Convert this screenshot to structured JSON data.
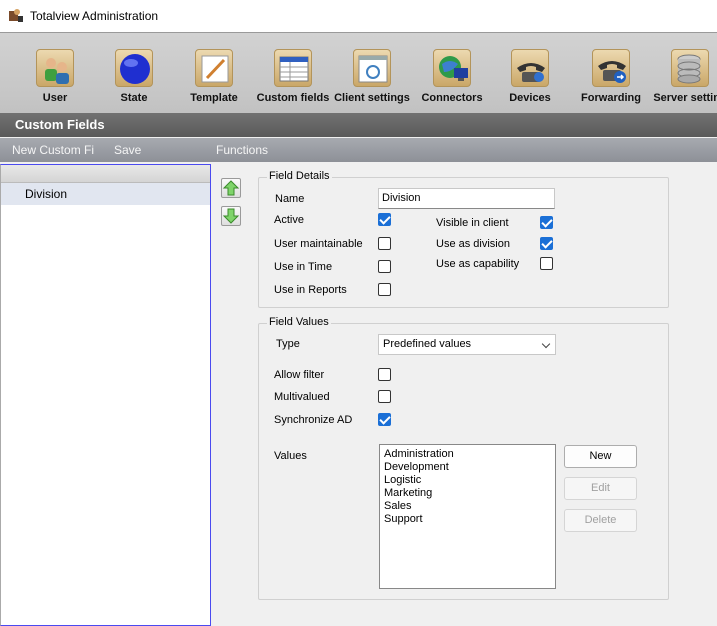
{
  "window": {
    "title": "Totalview  Administration"
  },
  "toolbar": {
    "items": [
      {
        "label": "User",
        "icon": "users-icon"
      },
      {
        "label": "State",
        "icon": "state-orb-icon"
      },
      {
        "label": "Template",
        "icon": "template-icon"
      },
      {
        "label": "Custom fields",
        "icon": "custom-fields-icon"
      },
      {
        "label": "Client settings",
        "icon": "client-settings-icon"
      },
      {
        "label": "Connectors",
        "icon": "connectors-icon"
      },
      {
        "label": "Devices",
        "icon": "devices-phone-icon"
      },
      {
        "label": "Forwarding",
        "icon": "forwarding-phone-icon"
      },
      {
        "label": "Server setting",
        "icon": "server-database-icon"
      }
    ],
    "section_title": "Custom Fields"
  },
  "menu": {
    "new": "New Custom Fi",
    "save": "Save",
    "functions": "Functions"
  },
  "field_list": {
    "items": [
      "Division"
    ]
  },
  "field_details": {
    "title": "Field Details",
    "name_label": "Name",
    "name_value": "Division",
    "active_label": "Active",
    "active": true,
    "user_maintainable_label": "User maintainable",
    "user_maintainable": false,
    "use_in_time_label": "Use in Time",
    "use_in_time": false,
    "use_in_reports_label": "Use in Reports",
    "use_in_reports": false,
    "visible_in_client_label": "Visible in client",
    "visible_in_client": true,
    "use_as_division_label": "Use as division",
    "use_as_division": true,
    "use_as_capability_label": "Use as capability",
    "use_as_capability": false
  },
  "field_values": {
    "title": "Field Values",
    "type_label": "Type",
    "type_value": "Predefined values",
    "allow_filter_label": "Allow filter",
    "allow_filter": false,
    "multivalued_label": "Multivalued",
    "multivalued": false,
    "sync_ad_label": "Synchronize AD",
    "sync_ad": true,
    "values_label": "Values",
    "values": [
      "Administration",
      "Development",
      "Logistic",
      "Marketing",
      "Sales",
      "Support"
    ],
    "new_label": "New",
    "edit_label": "Edit",
    "delete_label": "Delete"
  },
  "colors": {
    "accent": "#1a6fd6",
    "section_bar": "#626262",
    "menu_bar": "#989ba2",
    "list_selection": "#e1e6f0"
  }
}
